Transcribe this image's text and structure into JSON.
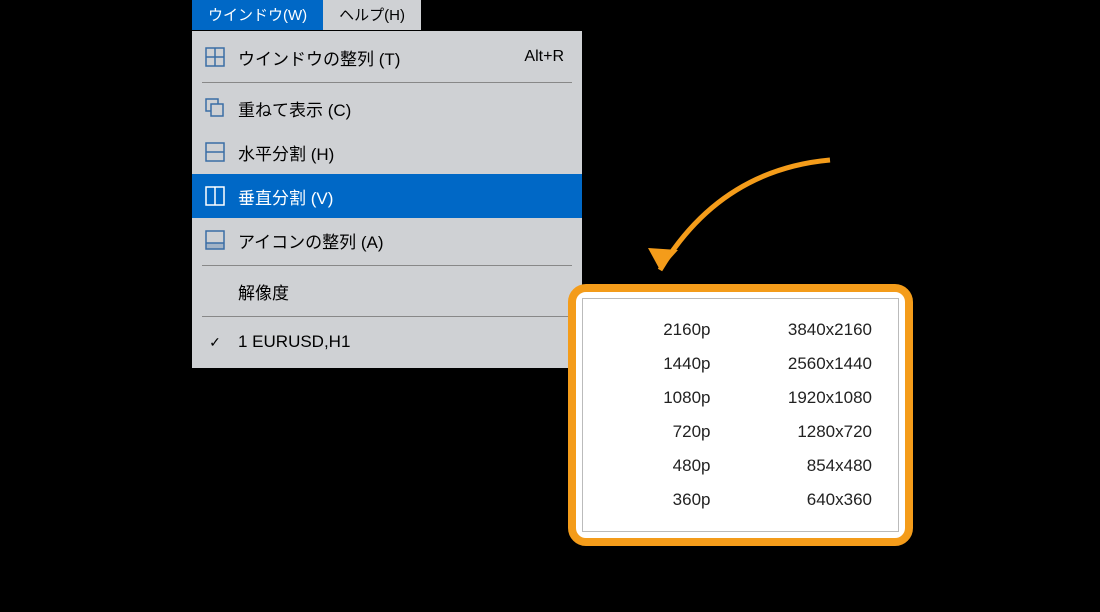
{
  "menubar": {
    "window": "ウインドウ(W)",
    "help": "ヘルプ(H)"
  },
  "menu": {
    "tile": {
      "label": "ウインドウの整列 (T)",
      "shortcut": "Alt+R"
    },
    "cascade": {
      "label": "重ねて表示 (C)"
    },
    "horiz": {
      "label": "水平分割 (H)"
    },
    "vert": {
      "label": "垂直分割 (V)"
    },
    "icons": {
      "label": "アイコンの整列 (A)"
    },
    "resolution": {
      "label": "解像度"
    },
    "win1": {
      "label": "1 EURUSD,H1"
    }
  },
  "resolutions": [
    {
      "p": "2160p",
      "wh": "3840x2160"
    },
    {
      "p": "1440p",
      "wh": "2560x1440"
    },
    {
      "p": "1080p",
      "wh": "1920x1080"
    },
    {
      "p": "720p",
      "wh": "1280x720"
    },
    {
      "p": "480p",
      "wh": "854x480"
    },
    {
      "p": "360p",
      "wh": "640x360"
    }
  ]
}
